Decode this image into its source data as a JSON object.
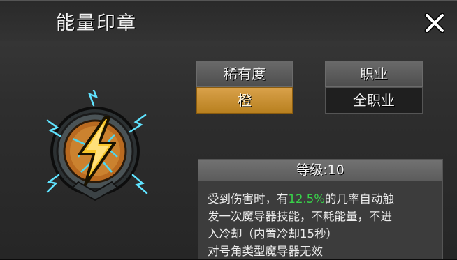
{
  "window": {
    "title": "能量印章"
  },
  "close_icon": "close-icon",
  "attributes": {
    "rarity": {
      "label": "稀有度",
      "value": "橙",
      "color": "#c98f2f"
    },
    "class": {
      "label": "职业",
      "value": "全职业"
    }
  },
  "item_icon": "lightning-seal-icon",
  "details": {
    "level_label": "等级:10",
    "desc_line1_a": "受到伤害时，有",
    "desc_line1_hl": "12.5%",
    "desc_line1_b": "的几率自动触",
    "desc_line2": "发一次魔导器技能，不耗能量，不进",
    "desc_line3": "入冷却（内置冷却15秒）",
    "desc_line4": "对号角类型魔导器无效",
    "highlight_color": "#39d24a"
  }
}
